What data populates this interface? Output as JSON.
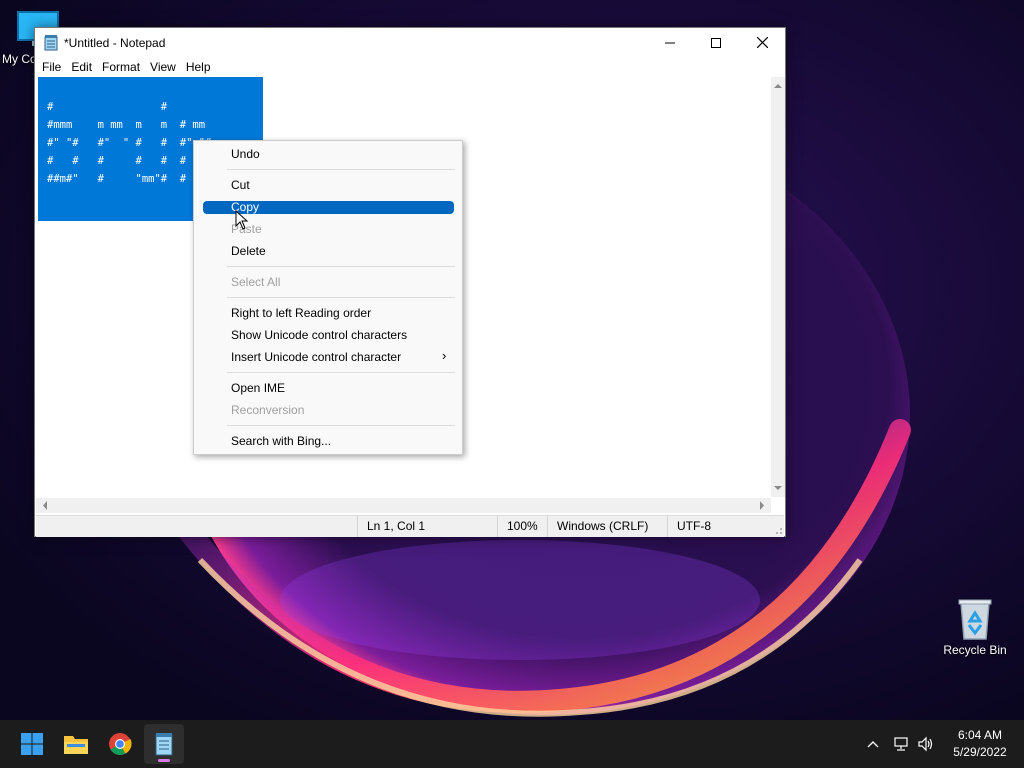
{
  "desktop": {
    "icons": [
      {
        "label": "My Co"
      },
      {
        "label": "Recycle Bin"
      }
    ]
  },
  "window": {
    "title": "*Untitled - Notepad",
    "menu": [
      "File",
      "Edit",
      "Format",
      "View",
      "Help"
    ],
    "editor_lines": [
      "#                 #",
      "#mmm    m mm  m   m  # mm",
      "#\" \"#   #\"  \" #   #  #\" \"#",
      "#   #   #     #   #  #   #",
      "##m#\"   #     \"mm\"#  #   #"
    ],
    "status": {
      "position": "Ln 1, Col 1",
      "zoom": "100%",
      "line_ending": "Windows (CRLF)",
      "encoding": "UTF-8"
    }
  },
  "context_menu": {
    "items": [
      {
        "label": "Undo",
        "enabled": true
      },
      {
        "label": "Cut",
        "enabled": true
      },
      {
        "label": "Copy",
        "enabled": true,
        "highlighted": true
      },
      {
        "label": "Paste",
        "enabled": false
      },
      {
        "label": "Delete",
        "enabled": true
      },
      {
        "label": "Select All",
        "enabled": false
      },
      {
        "label": "Right to left Reading order",
        "enabled": true
      },
      {
        "label": "Show Unicode control characters",
        "enabled": true
      },
      {
        "label": "Insert Unicode control character",
        "enabled": true
      },
      {
        "label": "Open IME",
        "enabled": true
      },
      {
        "label": "Reconversion",
        "enabled": false
      },
      {
        "label": "Search with Bing...",
        "enabled": true
      }
    ],
    "submenu_arrow": "›"
  },
  "taskbar": {
    "time": "6:04 AM",
    "date": "5/29/2022",
    "apps": [
      "start-icon",
      "file-explorer-icon",
      "chrome-icon",
      "notepad-icon"
    ]
  },
  "colors": {
    "selection": "#0078d7",
    "menu_highlight": "#0067c0",
    "taskbar": "#1c1c1c"
  }
}
